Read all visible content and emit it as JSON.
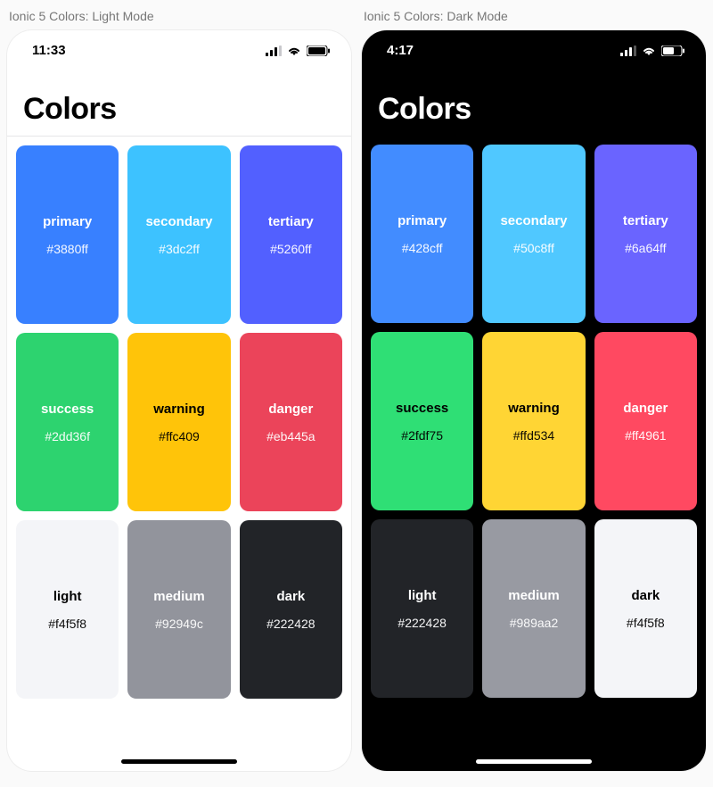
{
  "panes": [
    {
      "label": "Ionic 5 Colors: Light Mode",
      "mode": "light",
      "time": "11:33",
      "title": "Colors",
      "swatches": [
        {
          "name": "primary",
          "hex": "#3880ff",
          "bg": "#3880ff",
          "fg": "#ffffff"
        },
        {
          "name": "secondary",
          "hex": "#3dc2ff",
          "bg": "#3dc2ff",
          "fg": "#ffffff"
        },
        {
          "name": "tertiary",
          "hex": "#5260ff",
          "bg": "#5260ff",
          "fg": "#ffffff"
        },
        {
          "name": "success",
          "hex": "#2dd36f",
          "bg": "#2dd36f",
          "fg": "#ffffff"
        },
        {
          "name": "warning",
          "hex": "#ffc409",
          "bg": "#ffc409",
          "fg": "#000000"
        },
        {
          "name": "danger",
          "hex": "#eb445a",
          "bg": "#eb445a",
          "fg": "#ffffff"
        },
        {
          "name": "light",
          "hex": "#f4f5f8",
          "bg": "#f4f5f8",
          "fg": "#000000"
        },
        {
          "name": "medium",
          "hex": "#92949c",
          "bg": "#92949c",
          "fg": "#ffffff"
        },
        {
          "name": "dark",
          "hex": "#222428",
          "bg": "#222428",
          "fg": "#ffffff"
        }
      ]
    },
    {
      "label": "Ionic 5 Colors: Dark Mode",
      "mode": "dark",
      "time": "4:17",
      "title": "Colors",
      "swatches": [
        {
          "name": "primary",
          "hex": "#428cff",
          "bg": "#428cff",
          "fg": "#ffffff"
        },
        {
          "name": "secondary",
          "hex": "#50c8ff",
          "bg": "#50c8ff",
          "fg": "#ffffff"
        },
        {
          "name": "tertiary",
          "hex": "#6a64ff",
          "bg": "#6a64ff",
          "fg": "#ffffff"
        },
        {
          "name": "success",
          "hex": "#2fdf75",
          "bg": "#2fdf75",
          "fg": "#000000"
        },
        {
          "name": "warning",
          "hex": "#ffd534",
          "bg": "#ffd534",
          "fg": "#000000"
        },
        {
          "name": "danger",
          "hex": "#ff4961",
          "bg": "#ff4961",
          "fg": "#ffffff"
        },
        {
          "name": "light",
          "hex": "#222428",
          "bg": "#222428",
          "fg": "#ffffff"
        },
        {
          "name": "medium",
          "hex": "#989aa2",
          "bg": "#989aa2",
          "fg": "#ffffff"
        },
        {
          "name": "dark",
          "hex": "#f4f5f8",
          "bg": "#f4f5f8",
          "fg": "#000000"
        }
      ]
    }
  ]
}
